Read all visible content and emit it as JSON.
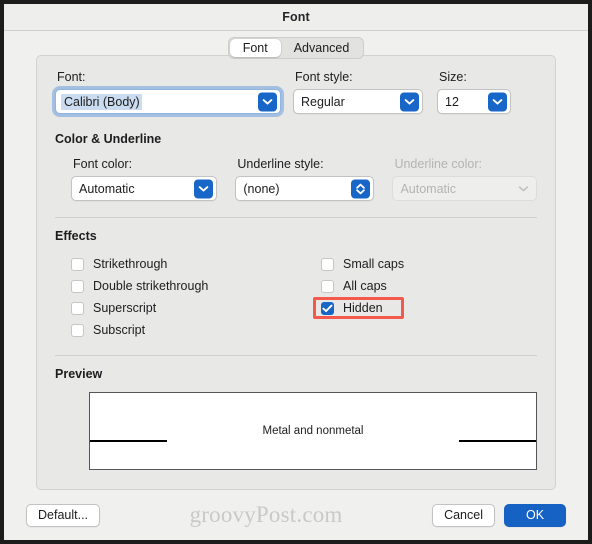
{
  "window": {
    "title": "Font"
  },
  "tabs": [
    {
      "label": "Font",
      "active": true
    },
    {
      "label": "Advanced",
      "active": false
    }
  ],
  "font_row": {
    "font": {
      "label": "Font:",
      "value": "Calibri (Body)",
      "icon": "chevron-down-icon",
      "focused": true
    },
    "font_style": {
      "label": "Font style:",
      "value": "Regular",
      "icon": "chevron-down-icon"
    },
    "size": {
      "label": "Size:",
      "value": "12",
      "icon": "chevron-down-icon"
    }
  },
  "color_underline": {
    "title": "Color & Underline",
    "font_color": {
      "label": "Font color:",
      "value": "Automatic",
      "icon": "chevron-down-icon",
      "disabled": false
    },
    "underline_style": {
      "label": "Underline style:",
      "value": "(none)",
      "icon": "chevron-up-down-icon",
      "disabled": false
    },
    "underline_color": {
      "label": "Underline color:",
      "value": "Automatic",
      "icon": "chevron-down-icon",
      "disabled": true
    }
  },
  "effects": {
    "title": "Effects",
    "left_column": [
      {
        "label": "Strikethrough",
        "checked": false
      },
      {
        "label": "Double strikethrough",
        "checked": false
      },
      {
        "label": "Superscript",
        "checked": false
      },
      {
        "label": "Subscript",
        "checked": false
      }
    ],
    "right_column": [
      {
        "label": "Small caps",
        "checked": false,
        "highlighted": false
      },
      {
        "label": "All caps",
        "checked": false,
        "highlighted": false
      },
      {
        "label": "Hidden",
        "checked": true,
        "highlighted": true
      }
    ]
  },
  "preview": {
    "title": "Preview",
    "text": "Metal and nonmetal"
  },
  "footer": {
    "default_label": "Default...",
    "watermark": "groovyPost.com",
    "cancel_label": "Cancel",
    "ok_label": "OK"
  },
  "colors": {
    "accent": "#1766c8",
    "primary_button": "#1661c4",
    "highlight_border": "#f4594c",
    "panel_bg": "#e8e8e6",
    "window_bg": "#f0f0ef",
    "selection": "#cbdcf0"
  }
}
